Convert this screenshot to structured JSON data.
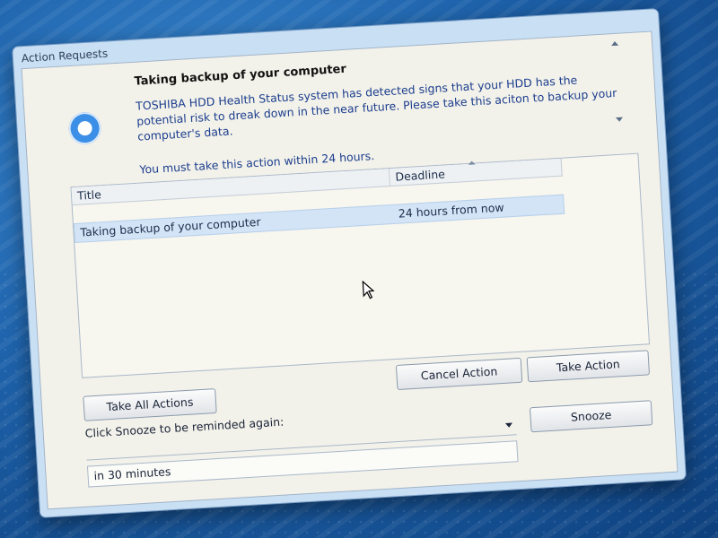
{
  "window": {
    "title": "Action Requests"
  },
  "message": {
    "icon": "beats-audio-icon",
    "title": "Taking backup of your computer",
    "body": "TOSHIBA HDD Health Status system has detected signs that your HDD has the potential risk to dreak down in the near future. Please take this aciton to backup your computer's data.",
    "deadline_note": "You must take this action within 24 hours."
  },
  "list": {
    "columns": [
      "Title",
      "Deadline"
    ],
    "rows": [
      {
        "title": "Taking backup of your computer",
        "deadline": "24 hours from now"
      }
    ]
  },
  "buttons": {
    "cancel_action": "Cancel Action",
    "take_action": "Take Action",
    "take_all_actions": "Take All Actions",
    "snooze": "Snooze"
  },
  "snooze": {
    "label": "Click Snooze to be reminded again:",
    "selected": "in 30 minutes"
  },
  "colors": {
    "accent": "#3c8fe6",
    "body_text": "#1c3e8e",
    "selected_row": "#d3e4f6"
  }
}
